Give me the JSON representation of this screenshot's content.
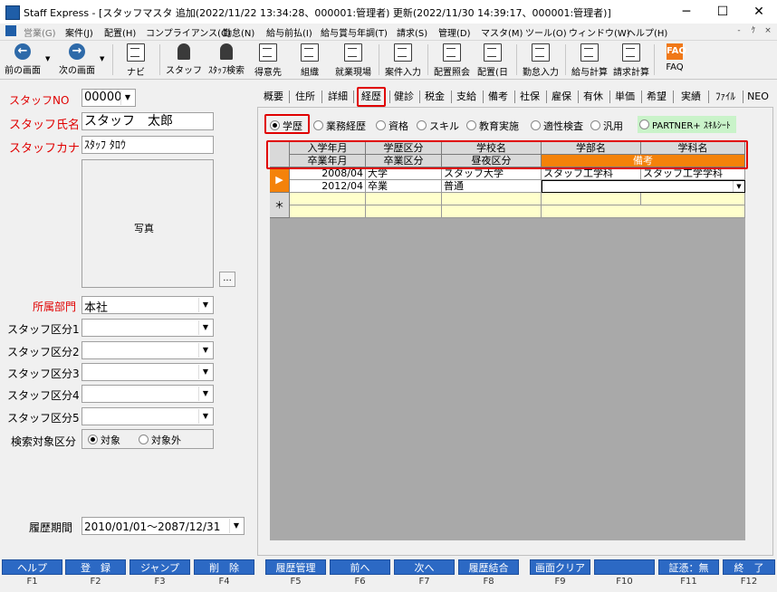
{
  "window": {
    "title": "Staff Express - [スタッフマスタ 追加(2022/11/22 13:34:28、000001:管理者) 更新(2022/11/30 14:39:17、000001:管理者)]",
    "minimize": "─",
    "maximize": "☐",
    "close": "✕"
  },
  "menu": {
    "items": [
      "営業(G)",
      "案件(J)",
      "配置(H)",
      "コンプライアンス(C)",
      "勤怠(N)",
      "給与前払(I)",
      "給与賞与年調(T)",
      "請求(S)",
      "管理(D)",
      "マスタ(M)",
      "ツール(O)",
      "ウィンドウ(W)",
      "ヘルプ(H)"
    ],
    "mdi_min": "-",
    "mdi_restore": "ｹ",
    "mdi_close": "×"
  },
  "toolbar": {
    "prev": "前の画面",
    "next": "次の画面",
    "navi": "ナビ",
    "staff": "スタッフ",
    "staff_search": "ｽﾀｯﾌ検索",
    "client": "得意先",
    "org": "組織",
    "site": "就業現場",
    "case_input": "案件入力",
    "assign_view": "配置照会",
    "assign_day": "配置(日",
    "attendance": "勤怠入力",
    "payroll": "給与計算",
    "billing": "請求計算",
    "faq": "FAQ",
    "faq_icon_text": "FAQ"
  },
  "left": {
    "staff_no_label": "スタッフNO",
    "staff_no": "000005",
    "staff_name_label": "スタッフ氏名",
    "staff_name": "スタッフ　太郎",
    "staff_kana_label": "スタッフカナ",
    "staff_kana": "ｽﾀｯﾌ ﾀﾛｳ",
    "photo_label": "写真",
    "photo_button": "...",
    "dept_label": "所属部門",
    "dept_value": "本社",
    "class_labels": [
      "スタッフ区分1",
      "スタッフ区分2",
      "スタッフ区分3",
      "スタッフ区分4",
      "スタッフ区分5"
    ],
    "search_target_label": "検索対象区分",
    "search_target_on": "対象",
    "search_target_off": "対象外",
    "history_period_label": "履歴期間",
    "history_period_value": "2010/01/01～2087/12/31"
  },
  "tabs": [
    "概要",
    "住所",
    "詳細",
    "経歴",
    "健診",
    "税金",
    "支給",
    "備考",
    "社保",
    "雇保",
    "有休",
    "単価",
    "希望",
    "実績",
    "ﾌｧｲﾙ",
    "NEO"
  ],
  "active_tab": "経歴",
  "radios": {
    "items": [
      "学歴",
      "業務経歴",
      "資格",
      "スキル",
      "教育実施",
      "適性検査",
      "汎用",
      "PARTNER+ ｽｷﾙｼｰﾄ"
    ],
    "selected": "学歴"
  },
  "grid": {
    "header_top": [
      "入学年月",
      "学歴区分",
      "学校名",
      "学部名",
      "学科名"
    ],
    "header_bottom": [
      "卒業年月",
      "卒業区分",
      "昼夜区分"
    ],
    "remarks_header": "備考",
    "rows": [
      {
        "top": [
          "2008/04",
          "大学",
          "スタッフ大学",
          "スタッフ工学科",
          "スタッフ工学学科"
        ],
        "bottom": [
          "2012/04",
          "卒業",
          "普通",
          ""
        ]
      }
    ],
    "current_row_marker": "▶",
    "new_row_marker": "＊"
  },
  "fkeys": [
    {
      "label": "ヘルプ",
      "key": "F1"
    },
    {
      "label": "登　録",
      "key": "F2"
    },
    {
      "label": "ジャンプ",
      "key": "F3"
    },
    {
      "label": "削　除",
      "key": "F4"
    },
    {
      "label": "履歴管理",
      "key": "F5"
    },
    {
      "label": "前へ",
      "key": "F6"
    },
    {
      "label": "次へ",
      "key": "F7"
    },
    {
      "label": "履歴結合",
      "key": "F8"
    },
    {
      "label": "画面クリア",
      "key": "F9"
    },
    {
      "label": "",
      "key": "F10"
    },
    {
      "label": "証憑：無",
      "key": "F11"
    },
    {
      "label": "終　了",
      "key": "F12"
    }
  ],
  "colors": {
    "accent_red": "#e00000",
    "fkey_blue": "#2c69c4",
    "header_orange": "#f4820a",
    "new_row_yellow": "#ffffcc"
  }
}
